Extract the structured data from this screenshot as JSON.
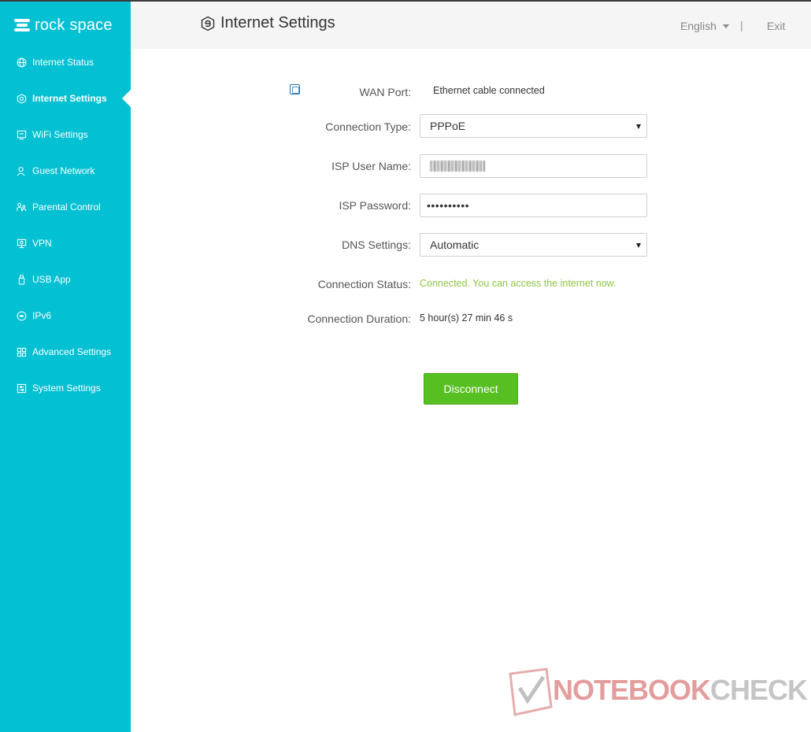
{
  "brand": {
    "name": "rock space"
  },
  "colors": {
    "sidebar": "#04c0d3",
    "status_ok": "#8dc63f",
    "button": "#58bf22"
  },
  "sidebar": {
    "items": [
      {
        "label": "Internet Status",
        "icon": "globe-icon"
      },
      {
        "label": "Internet Settings",
        "icon": "internet-settings-icon",
        "active": true
      },
      {
        "label": "WiFi Settings",
        "icon": "wifi-settings-icon"
      },
      {
        "label": "Guest Network",
        "icon": "guest-user-icon"
      },
      {
        "label": "Parental Control",
        "icon": "parental-control-icon"
      },
      {
        "label": "VPN",
        "icon": "vpn-monitor-icon"
      },
      {
        "label": "USB App",
        "icon": "usb-icon"
      },
      {
        "label": "IPv6",
        "icon": "ipv6-icon"
      },
      {
        "label": "Advanced Settings",
        "icon": "grid-icon"
      },
      {
        "label": "System Settings",
        "icon": "system-settings-icon"
      }
    ]
  },
  "header": {
    "title": "Internet Settings",
    "language": "English",
    "separator": "|",
    "exit": "Exit"
  },
  "form": {
    "wan_port": {
      "label": "WAN Port:",
      "value": "Ethernet cable connected"
    },
    "connection_type": {
      "label": "Connection Type:",
      "value": "PPPoE"
    },
    "isp_user_name": {
      "label": "ISP User Name:",
      "value": ""
    },
    "isp_password": {
      "label": "ISP Password:",
      "value": "••••••••••"
    },
    "dns_settings": {
      "label": "DNS Settings:",
      "value": "Automatic"
    },
    "connection_status": {
      "label": "Connection Status:",
      "value": "Connected. You can access the internet now."
    },
    "connection_duration": {
      "label": "Connection Duration:",
      "value": "5 hour(s) 27 min 46 s"
    }
  },
  "actions": {
    "disconnect": "Disconnect"
  },
  "watermark": {
    "prefix": "NOTEBOOK",
    "suffix": "CHECK"
  }
}
